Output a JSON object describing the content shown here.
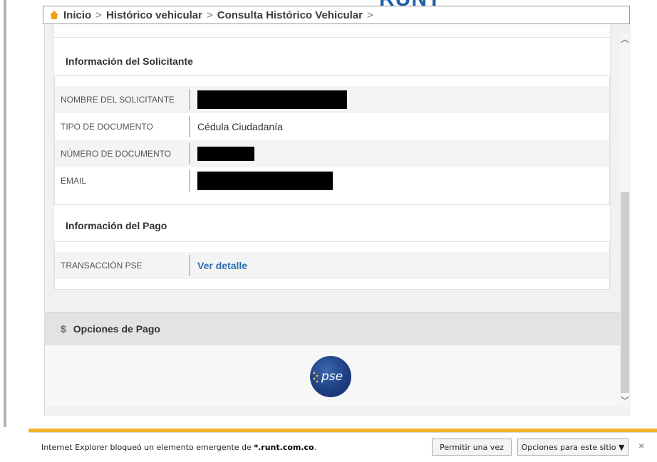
{
  "brand": "RUNT",
  "breadcrumb": {
    "items": [
      "Inicio",
      "Histórico vehicular",
      "Consulta Histórico Vehicular"
    ],
    "separator": ">"
  },
  "solicitante": {
    "title": "Información del Solicitante",
    "rows": [
      {
        "label": "NOMBRE DEL SOLICITANTE",
        "value": ""
      },
      {
        "label": "TIPO DE DOCUMENTO",
        "value": "Cédula Ciudadanía"
      },
      {
        "label": "NÚMERO DE DOCUMENTO",
        "value": ""
      },
      {
        "label": "EMAIL",
        "value": ""
      }
    ]
  },
  "pago": {
    "title": "Información del Pago",
    "row_label": "TRANSACCIÓN PSE",
    "row_link": "Ver detalle"
  },
  "opciones": {
    "title": "Opciones de Pago",
    "symbol": "$",
    "pse_label": "pse"
  },
  "ie_bar": {
    "message_prefix": "Internet Explorer bloqueó un elemento emergente de ",
    "domain": "*.runt.com.co",
    "message_suffix": ".",
    "allow_once": "Permitir una vez",
    "site_options": "Opciones para este sitio ▼",
    "close": "×"
  },
  "scroll": {
    "up": "︿",
    "down": "﹀"
  },
  "colors": {
    "accent_link": "#2f6fb3",
    "brand_blue": "#1f5fa8",
    "home_orange": "#f39c12",
    "footer_gold": "#f0b429"
  }
}
